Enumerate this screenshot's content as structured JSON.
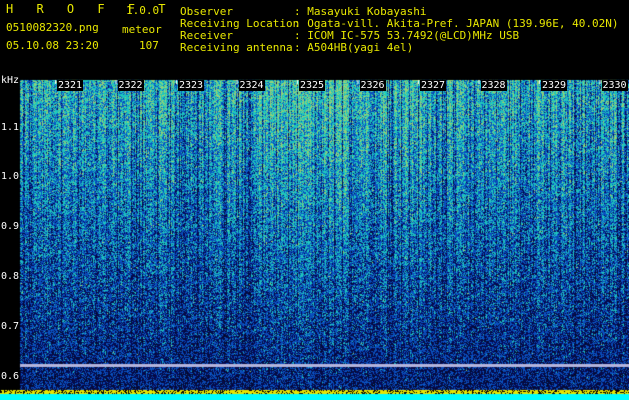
{
  "app": {
    "title": "H R O F F T",
    "version": "1.0.0",
    "filename": "0510082320.png",
    "mode": "meteor",
    "datetime": "05.10.08 23:20",
    "count": "107"
  },
  "info": {
    "labels": [
      "Observer",
      "Receiving Location",
      "Receiver",
      "Receiving antenna"
    ],
    "values": [
      ": Masayuki Kobayashi",
      ": Ogata-vill. Akita-Pref. JAPAN (139.96E, 40.02N)",
      ": ICOM IC-575 53.7492(@LCD)MHz USB",
      ": A504HB(yagi 4el)"
    ]
  },
  "chart_data": {
    "type": "heatmap",
    "title": "",
    "ylabel": "kHz",
    "y_ticks": [
      "1.1",
      "1.0",
      "0.9",
      "0.8",
      "0.7",
      "0.6"
    ],
    "x_ticks": [
      "2321",
      "2322",
      "2323",
      "2324",
      "2325",
      "2326",
      "2327",
      "2328",
      "2329",
      "2330"
    ],
    "colors": {
      "background": "#000000",
      "low": "#0a1a8c",
      "mid": "#1e6ad6",
      "high": "#3ce0c0",
      "peak": "#e8e800",
      "baseline": "#00ffff"
    }
  }
}
